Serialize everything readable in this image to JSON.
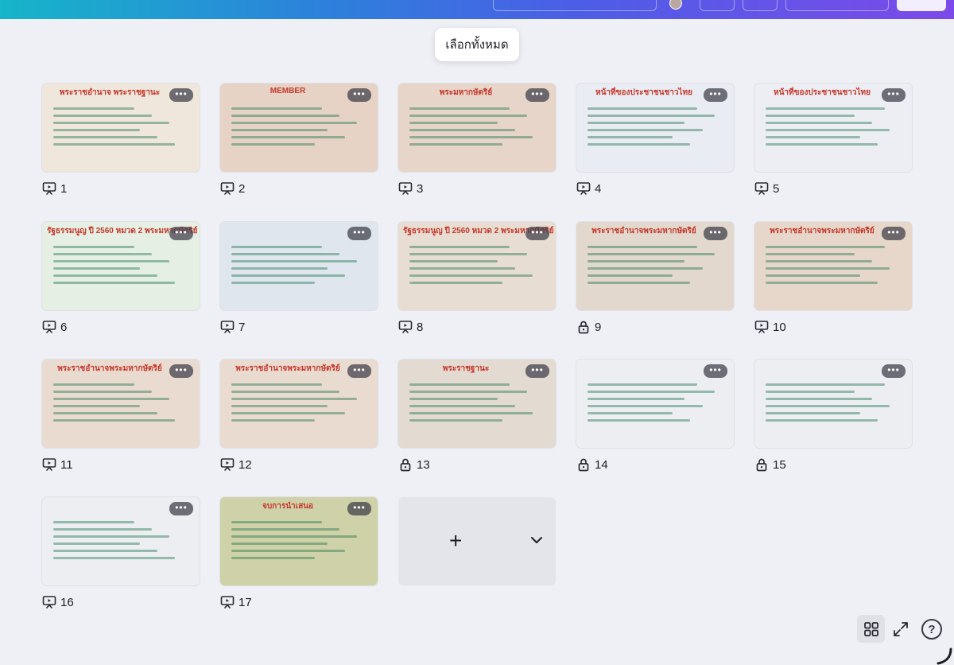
{
  "header": {
    "gradient_colors": [
      "#16b5c9",
      "#2e7fdc",
      "#4c5ee6",
      "#7c4ae8"
    ]
  },
  "select_all_label": "เลือกทั้งหมด",
  "slides": [
    {
      "number": "1",
      "title": "พระราชอำนาจ พระราชฐานะ",
      "status": "presenter-icon",
      "bg": "#efe6dc"
    },
    {
      "number": "2",
      "title": "MEMBER",
      "status": "presenter-icon",
      "bg": "#e6d3c6"
    },
    {
      "number": "3",
      "title": "พระมหากษัตริย์",
      "status": "presenter-icon",
      "bg": "#e6d5c8"
    },
    {
      "number": "4",
      "title": "หน้าที่ของประชาชนชาวไทย",
      "status": "presenter-icon",
      "bg": "#e9ecf2"
    },
    {
      "number": "5",
      "title": "หน้าที่ของประชาชนชาวไทย",
      "status": "presenter-icon",
      "bg": "#eceef3"
    },
    {
      "number": "6",
      "title": "รัฐธรรมนูญ ปี 2560 หมวด 2 พระมหากษัตริย์",
      "status": "presenter-icon",
      "bg": "#e6efe4"
    },
    {
      "number": "7",
      "title": "",
      "status": "presenter-icon",
      "bg": "#dfe6ee"
    },
    {
      "number": "8",
      "title": "รัฐธรรมนูญ ปี 2560 หมวด 2 พระมหากษัตริย์",
      "status": "presenter-icon",
      "bg": "#e8ddd2"
    },
    {
      "number": "9",
      "title": "พระราชอำนาจพระมหากษัตริย์",
      "status": "lock-icon",
      "bg": "#e2d8cd"
    },
    {
      "number": "10",
      "title": "พระราชอำนาจพระมหากษัตริย์",
      "status": "presenter-icon",
      "bg": "#e6d7ca"
    },
    {
      "number": "11",
      "title": "พระราชอำนาจพระมหากษัตริย์",
      "status": "presenter-icon",
      "bg": "#eadbd0"
    },
    {
      "number": "12",
      "title": "พระราชอำนาจพระมหากษัตริย์",
      "status": "presenter-icon",
      "bg": "#eadbd0"
    },
    {
      "number": "13",
      "title": "พระราชฐานะ",
      "status": "lock-icon",
      "bg": "#e3dbd2"
    },
    {
      "number": "14",
      "title": "",
      "status": "lock-icon",
      "bg": "#eceef2"
    },
    {
      "number": "15",
      "title": "",
      "status": "lock-icon",
      "bg": "#eceef2"
    },
    {
      "number": "16",
      "title": "",
      "status": "presenter-icon",
      "bg": "#eceef2"
    },
    {
      "number": "17",
      "title": "จบการนำเสนอ",
      "status": "presenter-icon",
      "bg": "#cfd2a8"
    }
  ],
  "more_label": "•••",
  "add_slide": {
    "plus": "+"
  },
  "help_label": "?"
}
